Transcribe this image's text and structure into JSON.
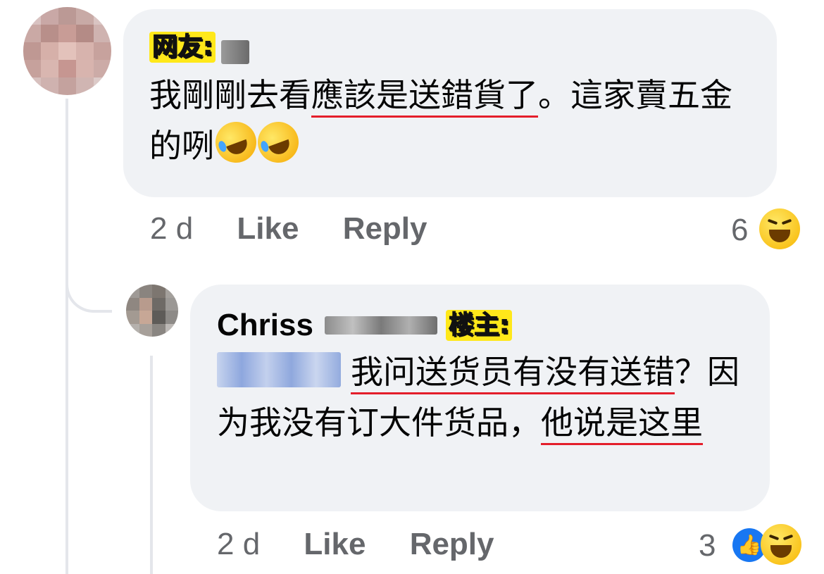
{
  "comments": [
    {
      "tag": "网友:",
      "text_parts": [
        "我剛剛去看",
        "應該是送錯貨了",
        "。這家賣五金的咧"
      ],
      "time": "2 d",
      "like_label": "Like",
      "reply_label": "Reply",
      "reaction_count": "6",
      "reaction_icons": [
        "haha-emoji"
      ]
    },
    {
      "name": "Chriss",
      "tag": "楼主:",
      "text_parts": [
        "我问送货员有没有送",
        "错",
        "？因为我没有订大件货品，",
        "他说是这里"
      ],
      "time": "2 d",
      "like_label": "Like",
      "reply_label": "Reply",
      "reaction_count": "3",
      "reaction_icons": [
        "like-emoji",
        "haha-emoji"
      ]
    }
  ],
  "colors": {
    "bubble": "#f0f2f5",
    "underline": "#e41e2b",
    "tag_highlight": "#ffe81a",
    "meta_text": "#65676b"
  }
}
